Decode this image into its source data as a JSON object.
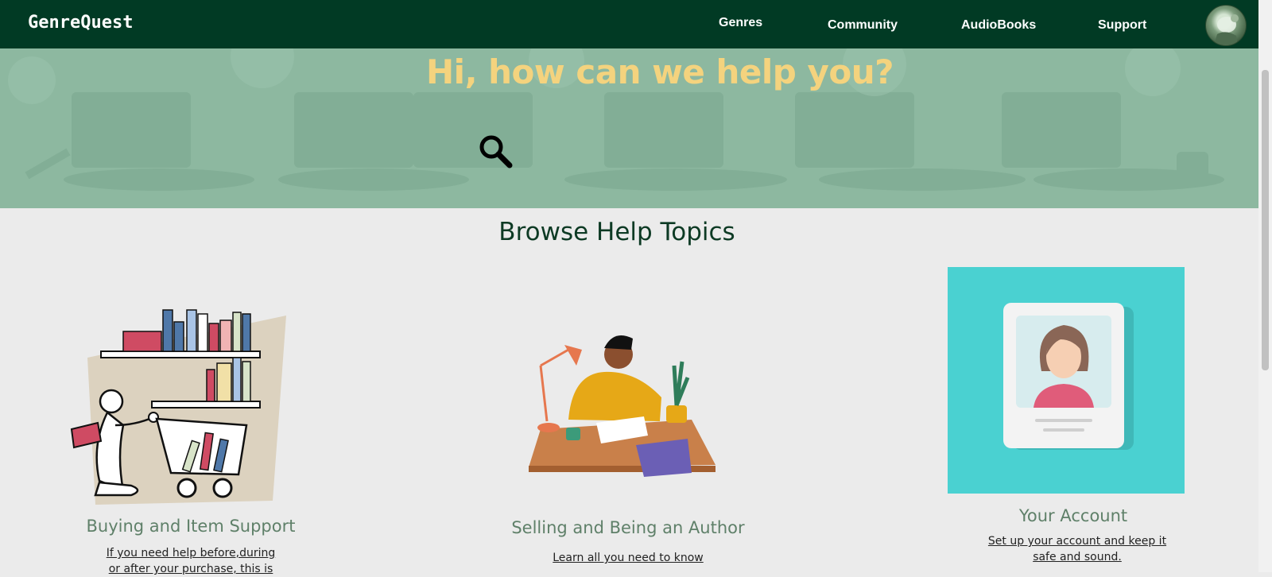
{
  "brand": {
    "logo": "GenreQuest"
  },
  "nav": {
    "links": [
      "Genres",
      "Community",
      "AudioBooks",
      "Support"
    ]
  },
  "hero": {
    "title": "Hi, how can we help you?"
  },
  "help": {
    "section_title": "Browse Help Topics",
    "cards": [
      {
        "title": "Buying and Item Support",
        "link_lines": [
          "If you need help before,during",
          "or after your purchase, this is"
        ],
        "illustration": "bookshelf-shopping-illustration"
      },
      {
        "title": "Selling and Being an Author",
        "link_lines": [
          "Learn all you need to know"
        ],
        "illustration": "author-writing-illustration"
      },
      {
        "title": "Your Account",
        "link_lines": [
          "Set up your account and keep it",
          "safe and sound."
        ],
        "illustration": "account-profile-illustration"
      }
    ]
  },
  "colors": {
    "navbar": "#013a24",
    "hero_overlay": "#8db8a0",
    "hero_title": "#f4d37e",
    "section_title": "#0d3a24",
    "card_title": "#5f8069",
    "account_bg": "#4ad1d1"
  },
  "icons": [
    "search-icon",
    "avatar"
  ]
}
